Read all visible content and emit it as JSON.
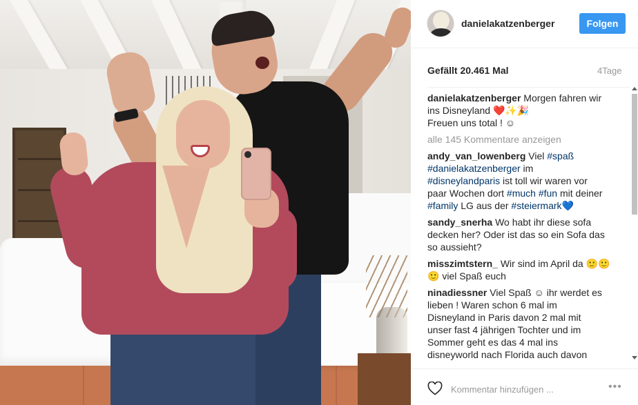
{
  "post": {
    "username": "danielakatzenberger",
    "follow_label": "Folgen",
    "likes": "Gefällt 20.461 Mal",
    "time": "4Tage"
  },
  "caption": {
    "user": "danielakatzenberger",
    "lines": [
      "Morgen fahren wir",
      "ins Disneyland ❤️✨🎉",
      "Freuen uns total ! ☺"
    ]
  },
  "view_all": "alle 145 Kommentare anzeigen",
  "comments": [
    {
      "user": "andy_van_lowenberg",
      "line1": "Viel ",
      "tag1": "#spaß",
      "tag2": "#danielakatzenberger",
      "text2": " im",
      "tag3": "#disneylandparis",
      "text3": " ist toll wir waren vor",
      "text4": "paar Wochen dort ",
      "tag4": "#much",
      "tag5": "#fun",
      "text5": " mit deiner",
      "tag6": "#family",
      "text6": " LG aus der ",
      "tag7": "#steiermark",
      "emoji": "💙"
    },
    {
      "user": "sandy_snerha",
      "line1": "Wo habt ihr diese sofa",
      "line2": "decken her? Oder ist das so ein Sofa das",
      "line3": "so aussieht?"
    },
    {
      "user": "misszimtstern_",
      "line1": "Wir sind im April da 🙂🙂",
      "line2": "🙂 viel Spaß euch"
    },
    {
      "user": "ninadiessner",
      "line1": "Viel Spaß ☺ ihr werdet es",
      "line2": "lieben ! Waren schon 6 mal im",
      "line3": "Disneyland in Paris davon 2 mal mit",
      "line4": "unser fast 4 jährigen Tochter und im",
      "line5": "Sommer geht es das 4 mal ins",
      "line6": "disneyworld nach Florida auch davon"
    }
  ],
  "footer": {
    "comment_placeholder": "Kommentar hinzufügen ...",
    "more_label": "•••"
  },
  "colors": {
    "follow_button": "#3897f0",
    "hashtag": "#003569"
  }
}
